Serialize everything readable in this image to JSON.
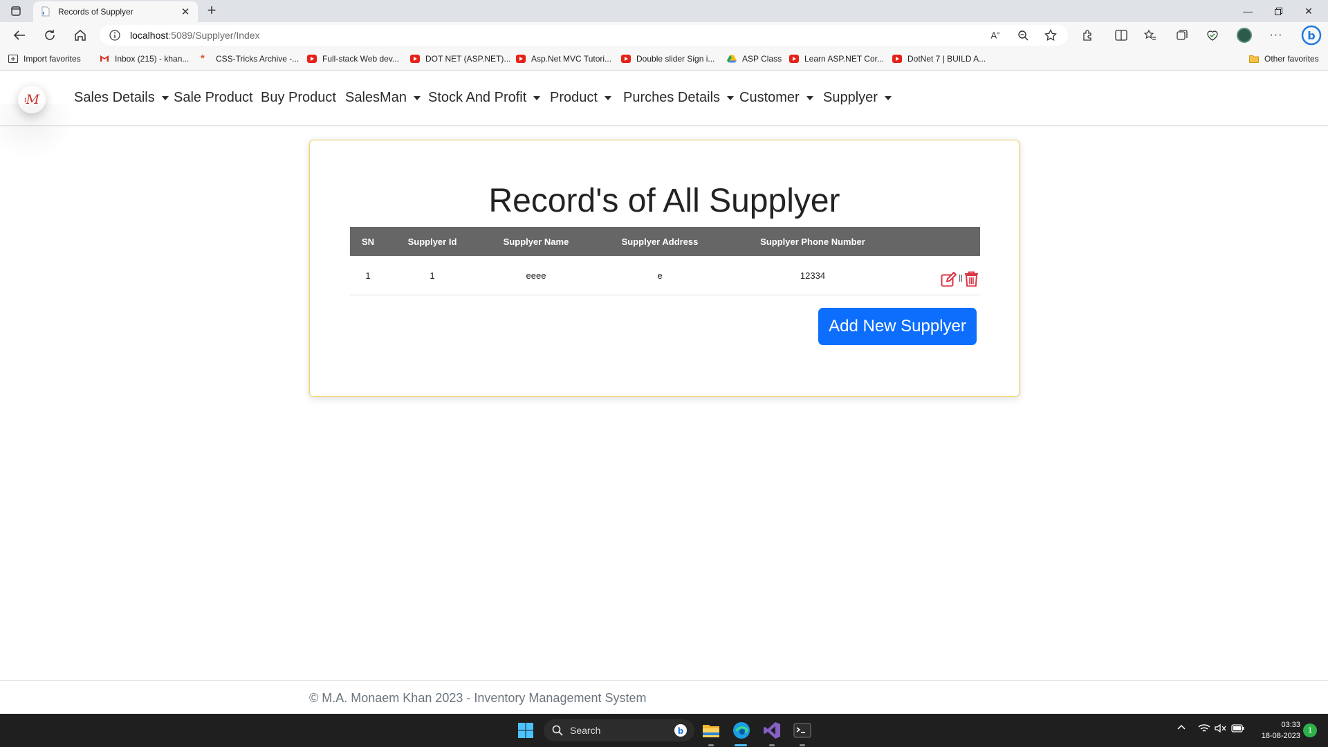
{
  "browser": {
    "tab_title": "Records of Supplyer",
    "url_host": "localhost",
    "url_path": ":5089/Supplyer/Index",
    "favorites": [
      {
        "label": "Import favorites",
        "icon": "import-icon"
      },
      {
        "label": "Inbox (215) - khan...",
        "icon": "gmail-icon"
      },
      {
        "label": "CSS-Tricks Archive -...",
        "icon": "css-tricks-icon"
      },
      {
        "label": "Full-stack Web dev...",
        "icon": "youtube-icon"
      },
      {
        "label": "DOT NET (ASP.NET)...",
        "icon": "youtube-icon"
      },
      {
        "label": "Asp.Net MVC Tutori...",
        "icon": "youtube-icon"
      },
      {
        "label": "Double slider Sign i...",
        "icon": "youtube-icon"
      },
      {
        "label": "ASP Class",
        "icon": "google-drive-icon"
      },
      {
        "label": "Learn ASP.NET Cor...",
        "icon": "youtube-icon"
      },
      {
        "label": "DotNet 7 | BUILD A...",
        "icon": "youtube-icon"
      }
    ],
    "other_favorites": "Other favorites"
  },
  "navbar": {
    "logo_text": "M",
    "items": [
      {
        "label": "Sales Details",
        "dropdown": true
      },
      {
        "label": "Sale Product",
        "dropdown": false
      },
      {
        "label": "Buy Product",
        "dropdown": false
      },
      {
        "label": "SalesMan",
        "dropdown": true
      },
      {
        "label": "Stock And Profit",
        "dropdown": true
      },
      {
        "label": "Product",
        "dropdown": true
      },
      {
        "label": "Purches Details",
        "dropdown": true
      },
      {
        "label": "Customer",
        "dropdown": true
      },
      {
        "label": "Supplyer",
        "dropdown": true
      }
    ]
  },
  "main": {
    "title": "Record's of All Supplyer",
    "table": {
      "headers": [
        "SN",
        "Supplyer Id",
        "Supplyer Name",
        "Supplyer Address",
        "Supplyer Phone Number"
      ],
      "rows": [
        {
          "sn": "1",
          "id": "1",
          "name": "eeee",
          "address": "e",
          "phone": "12334"
        }
      ],
      "action_separator": "||"
    },
    "add_button": "Add New Supplyer"
  },
  "footer": {
    "text": "© M.A. Monaem Khan 2023 - Inventory Management System"
  },
  "taskbar": {
    "search_label": "Search",
    "time": "03:33",
    "date": "18-08-2023",
    "notification_count": "1"
  },
  "colors": {
    "primary": "#0d6efd",
    "table_header": "#666666",
    "card_border": "#f1d25c",
    "action_red": "#dc3545"
  }
}
